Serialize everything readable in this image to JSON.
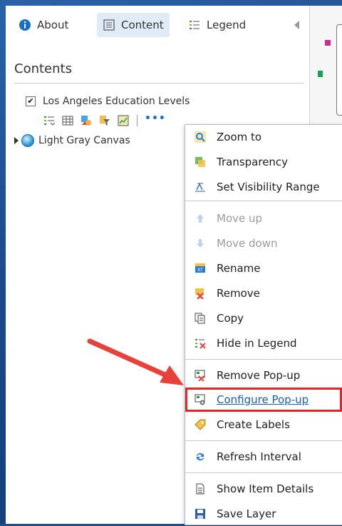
{
  "tabs": {
    "about": "About",
    "content": "Content",
    "legend": "Legend"
  },
  "contents": {
    "title": "Contents",
    "layer_name": "Los Angeles Education Levels",
    "basemap_name": "Light Gray Canvas",
    "more_label": "•••"
  },
  "menu": {
    "items": [
      {
        "label": "Zoom to",
        "icon": "zoom-to-icon"
      },
      {
        "label": "Transparency",
        "icon": "transparency-icon"
      },
      {
        "label": "Set Visibility Range",
        "icon": "visibility-range-icon"
      },
      {
        "label": "Move up",
        "icon": "arrow-up-icon"
      },
      {
        "label": "Move down",
        "icon": "arrow-down-icon"
      },
      {
        "label": "Rename",
        "icon": "rename-icon"
      },
      {
        "label": "Remove",
        "icon": "remove-icon"
      },
      {
        "label": "Copy",
        "icon": "copy-icon"
      },
      {
        "label": "Hide in Legend",
        "icon": "hide-in-legend-icon"
      },
      {
        "label": "Remove Pop-up",
        "icon": "remove-popup-icon"
      },
      {
        "label": "Configure Pop-up",
        "icon": "configure-popup-icon"
      },
      {
        "label": "Create Labels",
        "icon": "create-labels-icon"
      },
      {
        "label": "Refresh Interval",
        "icon": "refresh-icon"
      },
      {
        "label": "Show Item Details",
        "icon": "item-details-icon"
      },
      {
        "label": "Save Layer",
        "icon": "save-icon"
      }
    ]
  },
  "colors": {
    "accent": "#1b73c9",
    "highlight_border": "#e32626",
    "arrow": "#e8413a",
    "tab_active_bg": "#dfecf7"
  }
}
